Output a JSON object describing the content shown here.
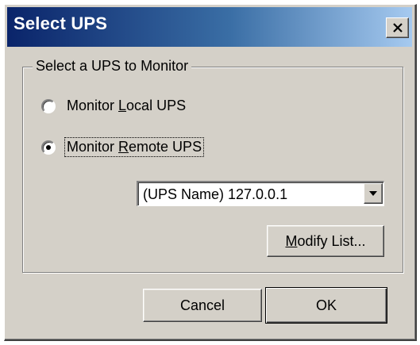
{
  "window": {
    "title": "Select UPS",
    "close_glyph": "×"
  },
  "group": {
    "label": "Select a UPS to Monitor"
  },
  "radios": {
    "local": {
      "label_pre": "Monitor ",
      "label_key": "L",
      "label_post": "ocal UPS",
      "checked": false
    },
    "remote": {
      "label_pre": "Monitor ",
      "label_key": "R",
      "label_post": "emote UPS",
      "checked": true
    }
  },
  "ups_select": {
    "value": "(UPS Name) 127.0.0.1"
  },
  "buttons": {
    "modify_key": "M",
    "modify_rest": "odify List...",
    "cancel": "Cancel",
    "ok": "OK"
  },
  "icons": {
    "close": "close-icon",
    "dropdown": "chevron-down-icon"
  },
  "colors": {
    "face": "#d4d0c8",
    "title_start": "#0a246a",
    "title_end": "#a6caf0"
  }
}
